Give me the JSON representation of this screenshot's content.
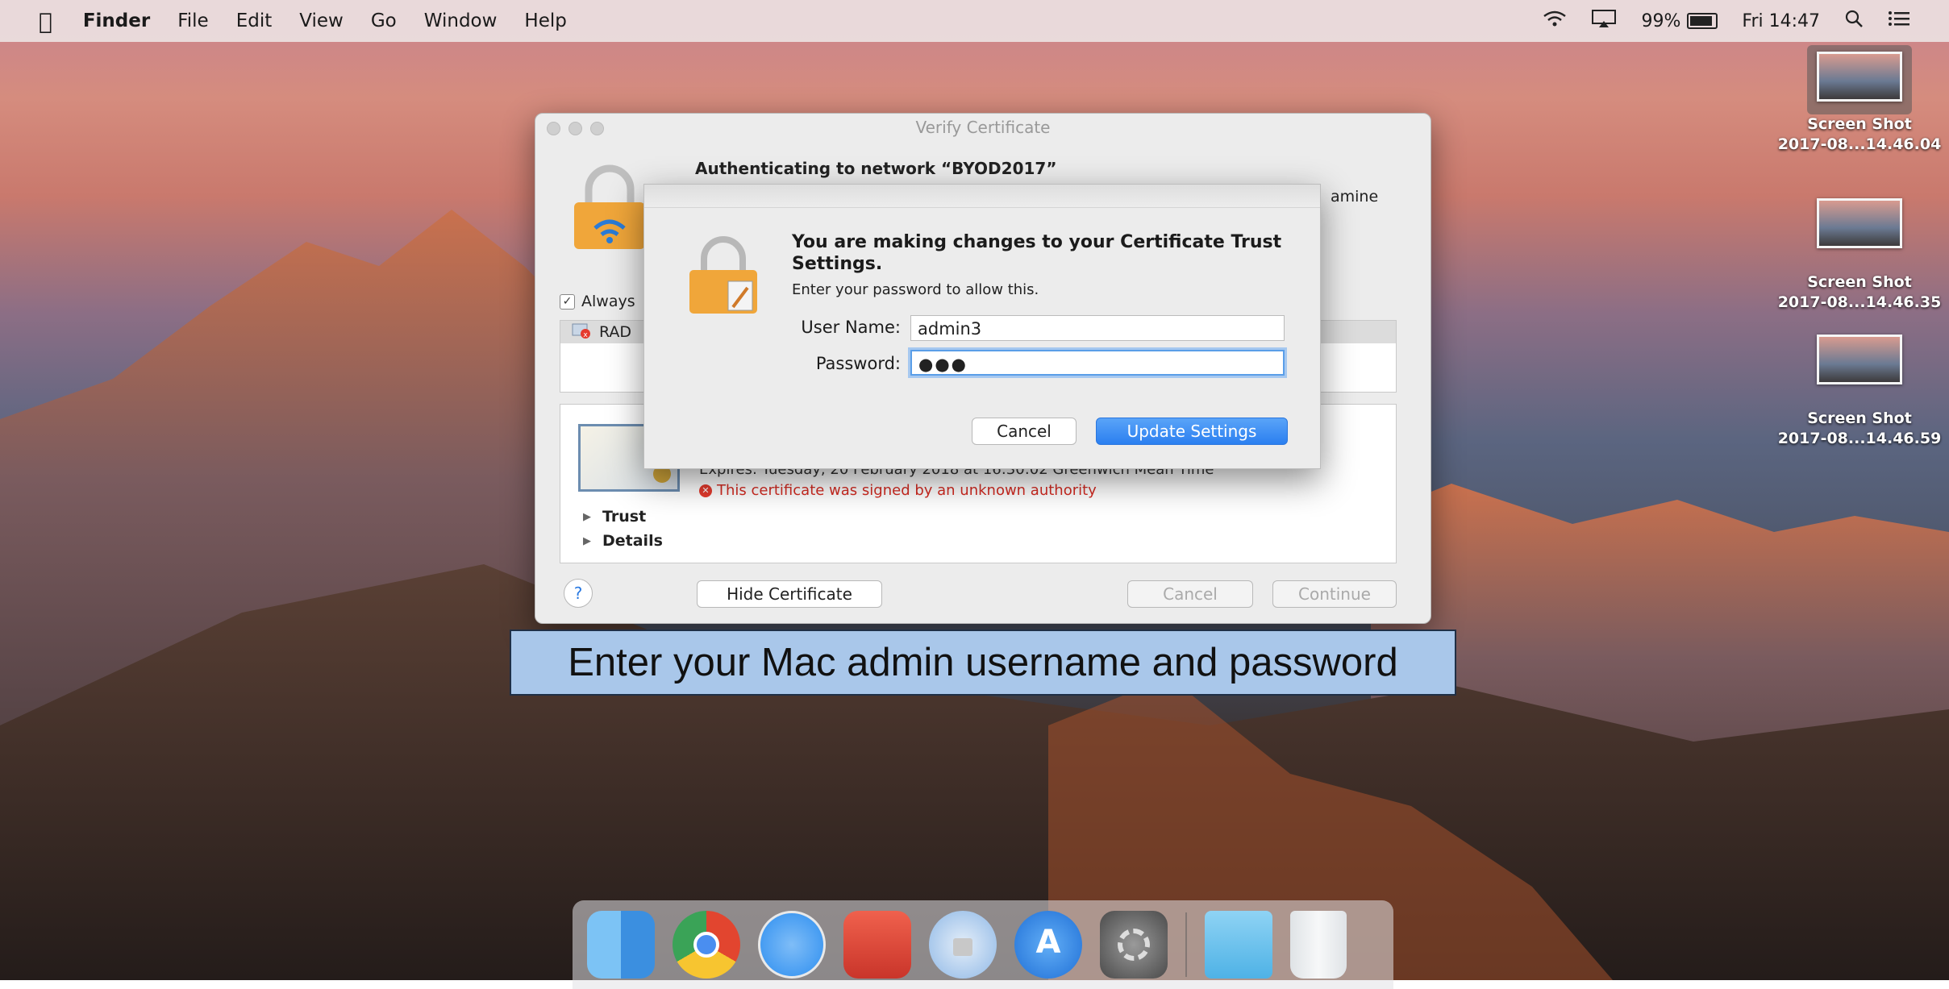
{
  "menubar": {
    "apple": "",
    "items": [
      "Finder",
      "File",
      "Edit",
      "View",
      "Go",
      "Window",
      "Help"
    ],
    "battery": "99%",
    "clock": "Fri 14:47"
  },
  "desktop_icons": [
    {
      "line1": "Screen Shot",
      "line2": "2017-08...14.46.04"
    },
    {
      "line1": "Screen Shot",
      "line2": "2017-08...14.46.35"
    },
    {
      "line1": "Screen Shot",
      "line2": "2017-08...14.46.59"
    }
  ],
  "verify_window": {
    "title": "Verify Certificate",
    "auth_title": "Authenticating to network “BYOD2017”",
    "examine_fragment": "amine",
    "always_label": "Always",
    "list_row": "RAD",
    "expires": "Expires: Tuesday, 20 February 2018 at 16:30:02 Greenwich Mean Time",
    "error": "This certificate was signed by an unknown authority",
    "trust_label": "Trust",
    "details_label": "Details",
    "help": "?",
    "hide_cert_button": "Hide Certificate",
    "cancel_button": "Cancel",
    "continue_button": "Continue"
  },
  "password_sheet": {
    "headline": "You are making changes to your Certificate Trust Settings.",
    "subtitle": "Enter your password to allow this.",
    "username_label": "User Name:",
    "username_value": "admin3",
    "password_label": "Password:",
    "password_value": "●●●",
    "cancel_button": "Cancel",
    "update_button": "Update Settings"
  },
  "caption": "Enter your Mac admin username and password",
  "dock": [
    {
      "icon": "finder-icon",
      "color": "#4aa3f0"
    },
    {
      "icon": "chrome-icon",
      "color": "#e2452f"
    },
    {
      "icon": "safari-icon",
      "color": "#2d8ef0"
    },
    {
      "icon": "remote-desktop-icon",
      "color": "#e04a3a"
    },
    {
      "icon": "keychain-icon",
      "color": "#9ec4ee"
    },
    {
      "icon": "app-store-icon",
      "color": "#2f86ea"
    },
    {
      "icon": "system-preferences-icon",
      "color": "#6d6d6d"
    },
    {
      "icon": "downloads-folder-icon",
      "color": "#6cc3ee"
    },
    {
      "icon": "trash-icon",
      "color": "#e6e9ec"
    }
  ]
}
